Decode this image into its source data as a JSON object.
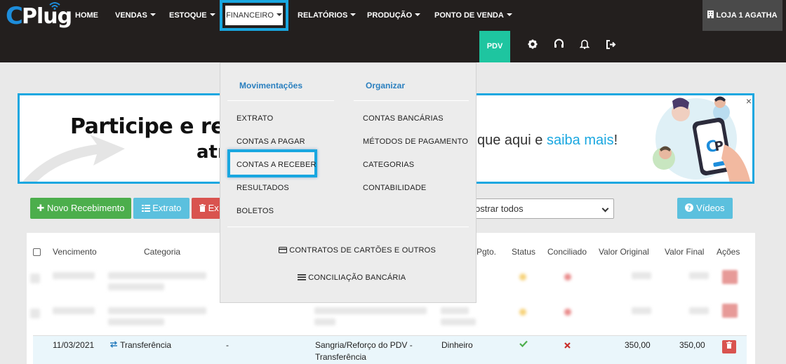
{
  "brand": {
    "logo_c": "C",
    "logo_plug": "Plug"
  },
  "nav": {
    "items": [
      {
        "label": "HOME",
        "caret": false
      },
      {
        "label": "VENDAS",
        "caret": true
      },
      {
        "label": "ESTOQUE",
        "caret": true
      },
      {
        "label": "FINANCEIRO",
        "caret": true
      },
      {
        "label": "RELATÓRIOS",
        "caret": true
      },
      {
        "label": "PRODUÇÃO",
        "caret": true
      },
      {
        "label": "PONTO DE VENDA",
        "caret": true
      }
    ],
    "store": "LOJA 1 AGATHA",
    "pdv": "PDV",
    "icons": [
      "gear-icon",
      "headset-icon",
      "bell-icon",
      "logout-icon"
    ]
  },
  "banner": {
    "line1": "Participe e rece",
    "line2": "atr",
    "sub_prefix": "que aqui e ",
    "sub_link": "saiba mais",
    "sub_suffix": "!",
    "close": "×"
  },
  "toolbar": {
    "new_label": "Novo Recebimento",
    "extrato_label": "Extrato",
    "excluir_label": "Ex",
    "filter_value": "ostrar todos",
    "videos_label": "Vídeos"
  },
  "table": {
    "headers": {
      "vencimento": "Vencimento",
      "categoria": "Categoria",
      "pgto": "Pgto.",
      "status": "Status",
      "conciliado": "Conciliado",
      "valor_original": "Valor Original",
      "valor_final": "Valor Final",
      "acoes": "Ações"
    },
    "row": {
      "vencimento": "11/03/2021",
      "categoria": "Transferência",
      "dash": "-",
      "descricao_1": "Sangria/Reforço do PDV -",
      "descricao_2": "Transferência",
      "pgto": "Dinheiro",
      "valor_original": "350,00",
      "valor_final": "350,00"
    }
  },
  "dropdown": {
    "col1_title": "Movimentações",
    "col2_title": "Organizar",
    "col1_items": [
      "EXTRATO",
      "CONTAS A PAGAR",
      "CONTAS A RECEBER",
      "RESULTADOS",
      "BOLETOS"
    ],
    "col2_items": [
      "CONTAS BANCÁRIAS",
      "MÉTODOS DE PAGAMENTO",
      "CATEGORIAS",
      "CONTABILIDADE"
    ],
    "bottom_items": [
      "CONTRATOS DE CARTÕES E OUTROS",
      "CONCILIAÇÃO BANCÁRIA"
    ]
  },
  "colors": {
    "accent": "#19a7e0",
    "nav_bg": "#231f1e",
    "pdv": "#1ec5a0",
    "green": "#4cae4c",
    "info": "#5bc0de",
    "danger": "#d9534f"
  }
}
